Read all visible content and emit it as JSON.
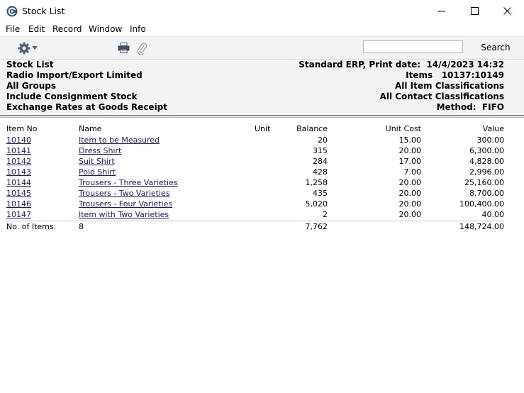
{
  "window": {
    "title": "Stock List"
  },
  "menu": [
    "File",
    "Edit",
    "Record",
    "Window",
    "Info"
  ],
  "toolbar": {
    "search_label": "Search",
    "search_value": ""
  },
  "header": {
    "left": [
      "Stock List",
      "Radio Import/Export Limited",
      "All Groups",
      "Include Consignment Stock",
      "Exchange Rates at Goods Receipt"
    ],
    "right": [
      "Standard ERP, Print date:  14/4/2023 14:32",
      "Items   10137:10149",
      "All Item Classifications",
      "All Contact Classifications",
      "Method:  FIFO"
    ]
  },
  "table": {
    "headers": {
      "item": "Item No",
      "name": "Name",
      "unit": "Unit",
      "balance": "Balance",
      "unit_cost": "Unit Cost",
      "value": "Value"
    },
    "rows": [
      {
        "item": "10140",
        "name": "Item to be Measured",
        "unit": "",
        "balance": "20",
        "unit_cost": "15.00",
        "value": "300.00"
      },
      {
        "item": "10141",
        "name": "Dress Shirt",
        "unit": "",
        "balance": "315",
        "unit_cost": "20.00",
        "value": "6,300.00"
      },
      {
        "item": "10142",
        "name": "Suit Shirt",
        "unit": "",
        "balance": "284",
        "unit_cost": "17.00",
        "value": "4,828.00"
      },
      {
        "item": "10143",
        "name": "Polo Shirt",
        "unit": "",
        "balance": "428",
        "unit_cost": "7.00",
        "value": "2,996.00"
      },
      {
        "item": "10144",
        "name": "Trousers - Three Varieties",
        "unit": "",
        "balance": "1,258",
        "unit_cost": "20.00",
        "value": "25,160.00"
      },
      {
        "item": "10145",
        "name": "Trousers - Two Varieties",
        "unit": "",
        "balance": "435",
        "unit_cost": "20.00",
        "value": "8,700.00"
      },
      {
        "item": "10146",
        "name": "Trousers - Four Varieties",
        "unit": "",
        "balance": "5,020",
        "unit_cost": "20.00",
        "value": "100,400.00"
      },
      {
        "item": "10147",
        "name": "Item with Two Varieties",
        "unit": "",
        "balance": "2",
        "unit_cost": "20.00",
        "value": "40.00"
      }
    ],
    "totals": {
      "label": "No. of Items:",
      "count": "8",
      "balance": "7,762",
      "value": "148,724.00"
    }
  }
}
